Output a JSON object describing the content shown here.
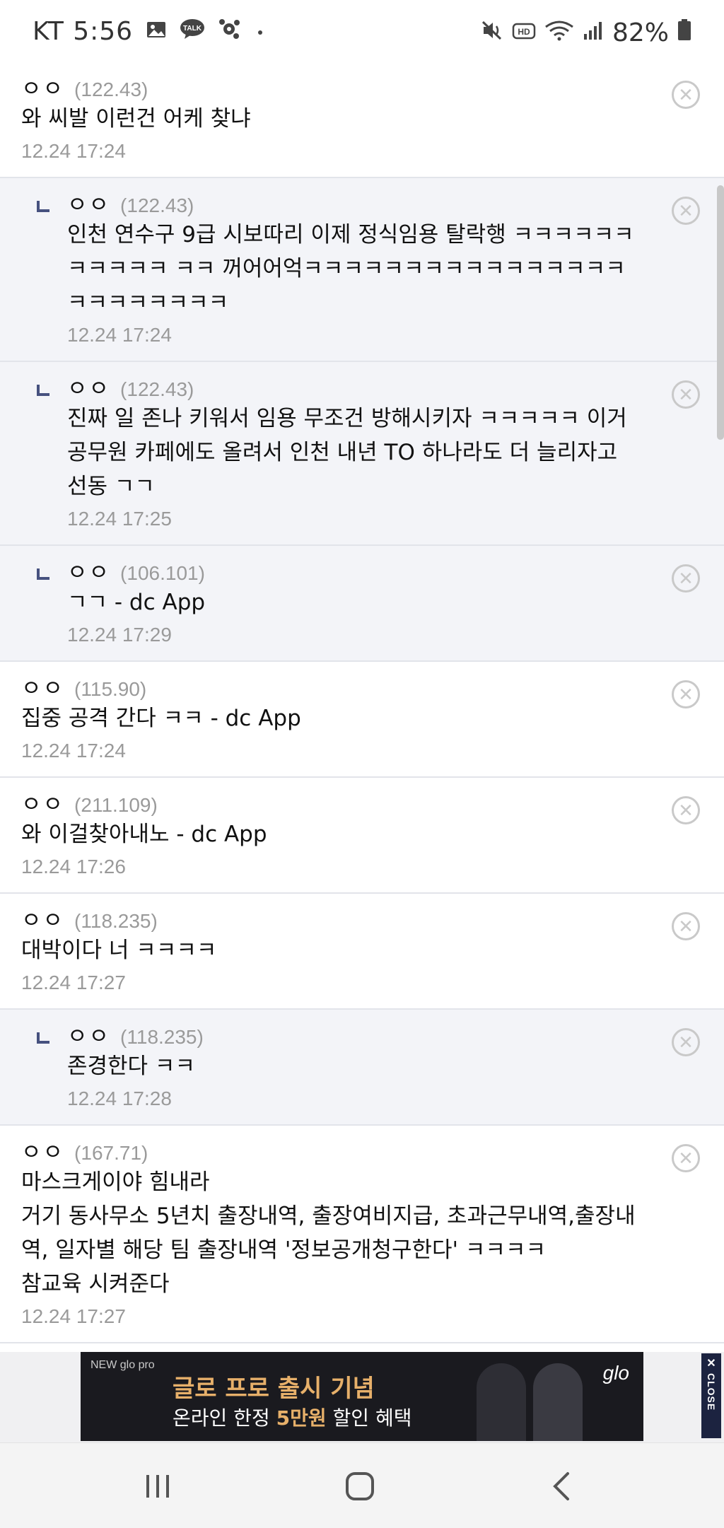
{
  "status_bar": {
    "carrier_time": "KT 5:56",
    "battery": "82%"
  },
  "comments": [
    {
      "reply": false,
      "nick": "ㅇㅇ",
      "ip": "(122.43)",
      "text": "와 씨발 이런건 어케 찾냐",
      "date": "12.24 17:24"
    },
    {
      "reply": true,
      "nick": "ㅇㅇ",
      "ip": "(122.43)",
      "text": "인천 연수구 9급 시보따리 이제 정식임용 탈락행 ㅋㅋㅋㅋㅋㅋㅋㅋㅋㅋㅋ ㅋㅋ 꺼어어억ㅋㅋㅋㅋㅋㅋㅋㅋㅋㅋㅋㅋㅋㅋㅋㅋㅋㅋㅋㅋㅋㅋㅋㅋ",
      "date": "12.24 17:24"
    },
    {
      "reply": true,
      "nick": "ㅇㅇ",
      "ip": "(122.43)",
      "text": "진짜 일 존나 키워서 임용 무조건 방해시키자 ㅋㅋㅋㅋㅋ 이거 공무원 카페에도 올려서 인천 내년 TO 하나라도 더 늘리자고 선동 ㄱㄱ",
      "date": "12.24 17:25"
    },
    {
      "reply": true,
      "nick": "ㅇㅇ",
      "ip": "(106.101)",
      "text": "ㄱㄱ - dc App",
      "date": "12.24 17:29"
    },
    {
      "reply": false,
      "nick": "ㅇㅇ",
      "ip": "(115.90)",
      "text": "집중 공격 간다 ㅋㅋ - dc App",
      "date": "12.24 17:24"
    },
    {
      "reply": false,
      "nick": "ㅇㅇ",
      "ip": "(211.109)",
      "text": "와 이걸찾아내노 - dc App",
      "date": "12.24 17:26"
    },
    {
      "reply": false,
      "nick": "ㅇㅇ",
      "ip": "(118.235)",
      "text": "대박이다 너 ㅋㅋㅋㅋ",
      "date": "12.24 17:27"
    },
    {
      "reply": true,
      "nick": "ㅇㅇ",
      "ip": "(118.235)",
      "text": "존경한다 ㅋㅋ",
      "date": "12.24 17:28"
    },
    {
      "reply": false,
      "nick": "ㅇㅇ",
      "ip": "(167.71)",
      "text": "마스크게이야 힘내라\n거기 동사무소 5년치 출장내역, 출장여비지급, 초과근무내역,출장내역, 일자별 해당 팀 출장내역 '정보공개청구한다' ㅋㅋㅋㅋ\n참교육 시켜준다",
      "date": "12.24 17:27"
    }
  ],
  "ad": {
    "brand": "NEW glo pro",
    "title": "글로 프로 출시 기념",
    "subtitle_pre": "온라인 한정 ",
    "subtitle_highlight": "5만원",
    "subtitle_post": " 할인 혜택",
    "logo": "glo",
    "close_x": "✕",
    "close_label": "CLOSE"
  },
  "colors": {
    "reply_bg": "#f3f4f8",
    "reply_marker": "#46517f",
    "ad_accent": "#e7b06a"
  }
}
